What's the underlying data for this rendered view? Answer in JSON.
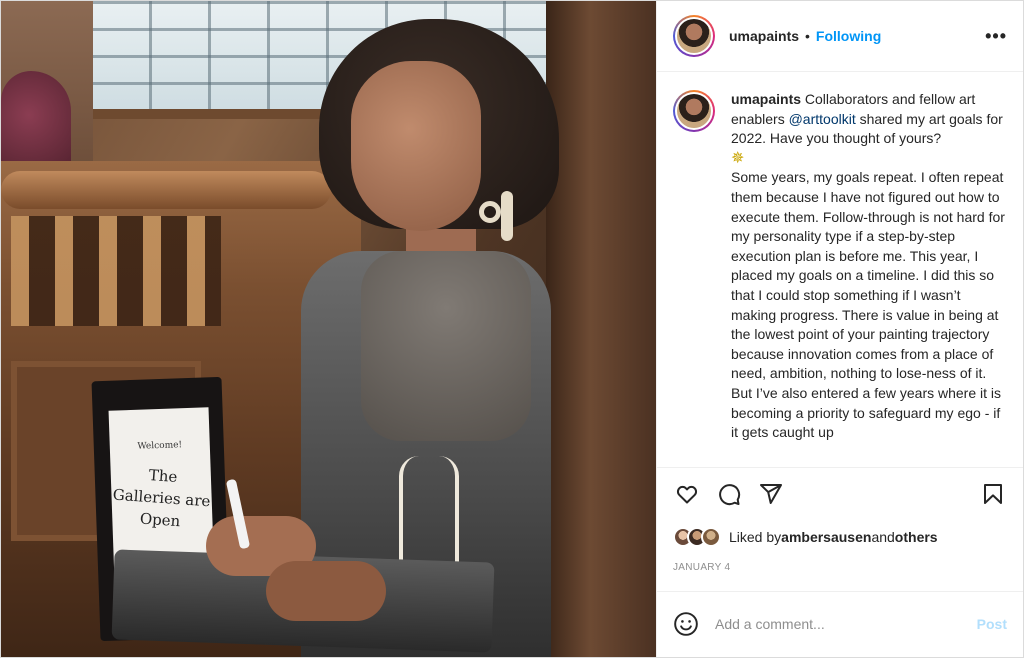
{
  "post": {
    "username": "umapaints",
    "follow_separator": "•",
    "follow_status": "Following",
    "more_label": "•••"
  },
  "photo": {
    "sign_small_text": "Welcome!",
    "sign_main_text": "The Galleries are Open"
  },
  "caption": {
    "username": "umapaints",
    "text_before_mention": " Collaborators and fellow art enablers ",
    "mention": "@arttoolkit",
    "text_after_mention": " shared my art goals for 2022. Have you thought of yours?",
    "emoji": "✵",
    "body": "Some years, my goals repeat. I often repeat them because I have not figured out how to execute them. Follow-through is not hard for my personality type if a step-by-step execution plan is before me. This year, I placed my goals on a timeline. I did this so that I could stop something if I wasn’t making progress. There is value in being at the lowest point of your painting trajectory because innovation comes from a place of need, ambition, nothing to lose-ness of it. But I’ve also entered a few years where it is becoming a priority to safeguard my ego - if it gets caught up"
  },
  "likes": {
    "prefix": "Liked by ",
    "user": "ambersausen",
    "middle": " and ",
    "others": "others"
  },
  "date": "JANUARY 4",
  "comment": {
    "placeholder": "Add a comment...",
    "post_label": "Post"
  },
  "colors": {
    "link_blue": "#0095f6",
    "post_disabled": "#b2dffc",
    "mention": "#00376b",
    "muted": "#8e8e8e"
  }
}
